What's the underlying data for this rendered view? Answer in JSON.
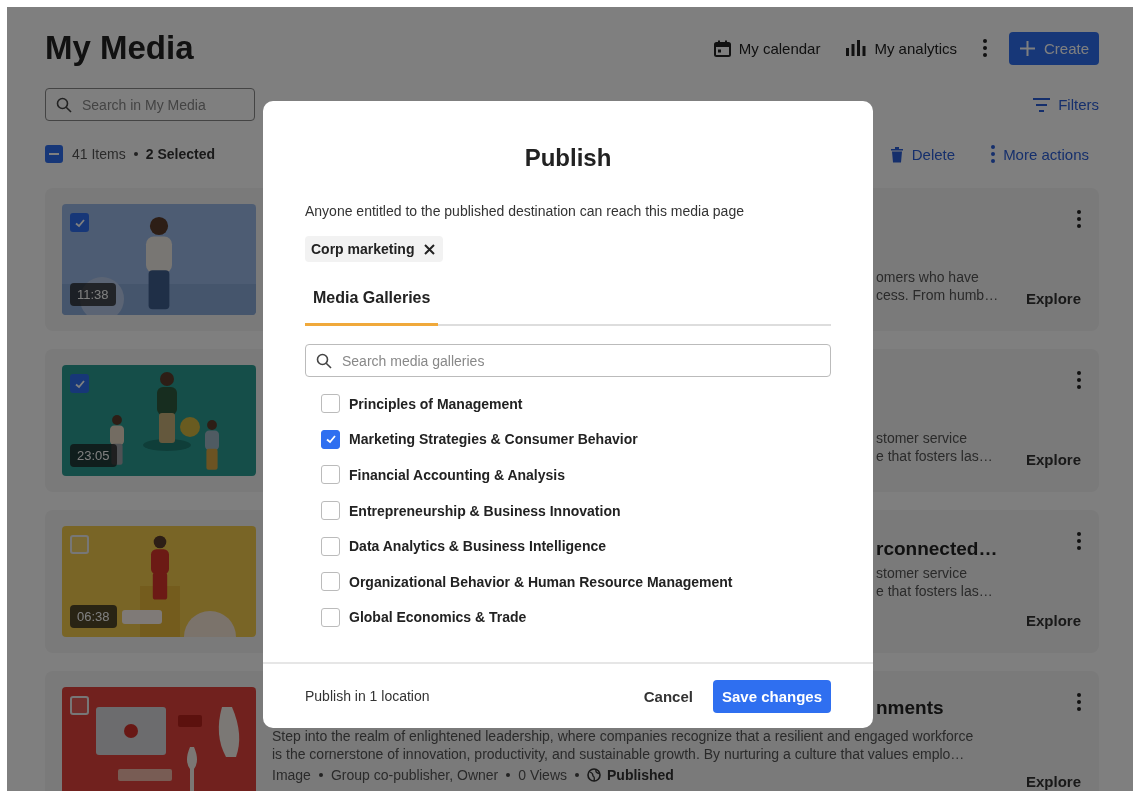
{
  "header": {
    "title": "My Media",
    "calendar_link": "My calendar",
    "analytics_link": "My analytics",
    "create_button": "Create"
  },
  "toolbar": {
    "search_placeholder": "Search in My Media",
    "filters": "Filters",
    "select_all": {
      "indeterminate": true
    },
    "items_count": "41 Items",
    "selected_count": "2 Selected",
    "bulk_actions": [
      {
        "kind": "trash",
        "label": "Delete"
      },
      {
        "kind": "kebab",
        "label": "More actions"
      }
    ]
  },
  "media": [
    {
      "selected": true,
      "duration": "11:38",
      "description": [
        "omers who have",
        "cess. From humb…"
      ],
      "explore": "Explore"
    },
    {
      "selected": true,
      "duration": "23:05",
      "description": [
        "stomer service",
        "e that fosters las…"
      ],
      "explore": "Explore"
    },
    {
      "selected": false,
      "duration": "06:38",
      "title": "rconnected…",
      "description": [
        "stomer service",
        "e that fosters las…"
      ],
      "explore": "Explore"
    },
    {
      "selected": false,
      "title": "nments",
      "description": [
        "Step into the realm of enlightened leadership, where companies recognize that a resilient and engaged workforce",
        "is the cornerstone of innovation, productivity, and sustainable growth. By nurturing a culture that values emplo…"
      ],
      "meta": [
        "Image",
        "Group co-publisher, Owner",
        "0 Views",
        "Published"
      ],
      "explore": "Explore"
    }
  ],
  "dialog": {
    "title": "Publish",
    "description": "Anyone entitled to the published destination can reach this media page",
    "chips": [
      {
        "label": "Corp marketing"
      }
    ],
    "tabs": [
      {
        "label": "Media Galleries",
        "selected": true
      }
    ],
    "search_placeholder": "Search media galleries",
    "galleries": [
      {
        "label": "Principles of Management",
        "checked": false
      },
      {
        "label": "Marketing Strategies & Consumer Behavior",
        "checked": true
      },
      {
        "label": "Financial Accounting & Analysis",
        "checked": false
      },
      {
        "label": "Entrepreneurship & Business Innovation",
        "checked": false
      },
      {
        "label": "Data Analytics & Business Intelligence",
        "checked": false
      },
      {
        "label": "Organizational Behavior & Human Resource Management",
        "checked": false
      },
      {
        "label": "Global Economics & Trade",
        "checked": false
      }
    ],
    "summary": "Publish in 1 location",
    "cancel_button": "Cancel",
    "save_button": "Save changes"
  }
}
